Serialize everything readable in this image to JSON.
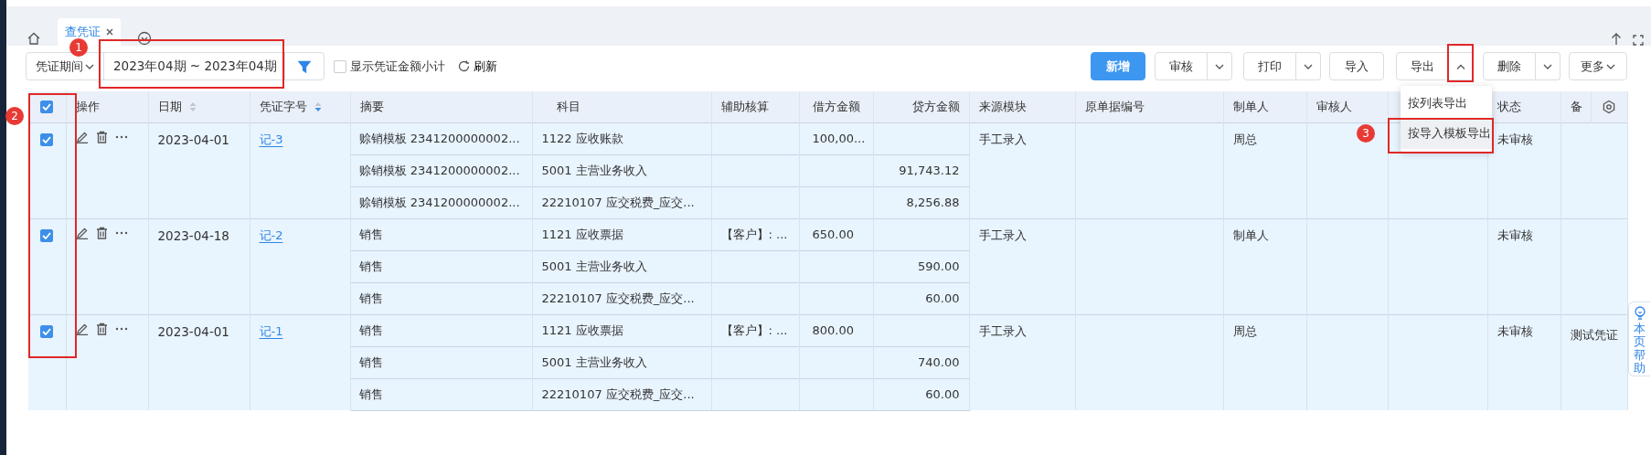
{
  "tabs_bar": {
    "tabs": [
      {
        "label": "查凭证",
        "selected": true
      }
    ]
  },
  "toolbar": {
    "period_select": "凭证期间",
    "date_range": "2023年04期 ~ 2023年04期",
    "subtotal_checkbox": {
      "label": "显示凭证金额小计",
      "checked": false
    },
    "refresh": "刷新",
    "buttons": [
      {
        "label": "新增",
        "kind": "primary"
      },
      {
        "label": "审核",
        "kind": "split",
        "expanded": false
      },
      {
        "label": "打印",
        "kind": "split",
        "expanded": false
      },
      {
        "label": "导入",
        "kind": "plain"
      },
      {
        "label": "导出",
        "kind": "split",
        "expanded": true
      },
      {
        "label": "删除",
        "kind": "split",
        "expanded": false
      },
      {
        "label": "更多",
        "kind": "dropdown"
      }
    ]
  },
  "export_menu": {
    "items": [
      {
        "label": "按列表导出",
        "selected": false
      },
      {
        "label": "按导入模板导出",
        "selected": true
      }
    ]
  },
  "table": {
    "select_all_checked": true,
    "columns": [
      {
        "label": "操作"
      },
      {
        "label": "日期",
        "sortable": true,
        "sorted_desc": false
      },
      {
        "label": "凭证字号",
        "sortable": true,
        "sorted_desc": true
      },
      {
        "label": "摘要"
      },
      {
        "label": "科目"
      },
      {
        "label": "辅助核算"
      },
      {
        "label": "借方金额"
      },
      {
        "label": "贷方金额"
      },
      {
        "label": "来源模块"
      },
      {
        "label": "原单据编号"
      },
      {
        "label": "制单人"
      },
      {
        "label": "审核人"
      },
      {
        "covered": true
      },
      {
        "label": "状态"
      },
      {
        "label": "备"
      }
    ],
    "rows": [
      {
        "checked": true,
        "date": "2023-04-01",
        "voucher_no": "记-3",
        "source": "手工录入",
        "maker": "周总",
        "status": "未审核",
        "entries": [
          {
            "summary": "赊销模板 2341200000002...",
            "account": "1122 应收账款",
            "debit": "100,00..."
          },
          {
            "summary": "赊销模板 2341200000002...",
            "account": "5001 主营业务收入",
            "credit": "91,743.12"
          },
          {
            "summary": "赊销模板 2341200000002...",
            "account": "22210107 应交税费_应交...",
            "credit": "8,256.88"
          }
        ]
      },
      {
        "checked": true,
        "date": "2023-04-18",
        "voucher_no": "记-2",
        "source": "手工录入",
        "maker": "制单人",
        "status": "未审核",
        "entries": [
          {
            "summary": "销售",
            "account": "1121 应收票据",
            "auxiliary": "【客户】: ...",
            "debit": "650.00"
          },
          {
            "summary": "销售",
            "account": "5001 主营业务收入",
            "credit": "590.00"
          },
          {
            "summary": "销售",
            "account": "22210107 应交税费_应交...",
            "credit": "60.00"
          }
        ]
      },
      {
        "checked": true,
        "date": "2023-04-01",
        "voucher_no": "记-1",
        "source": "手工录入",
        "maker": "周总",
        "status": "未审核",
        "remark": "测试凭证",
        "entries": [
          {
            "summary": "销售",
            "account": "1121 应收票据",
            "auxiliary": "【客户】: ...",
            "debit": "800.00"
          },
          {
            "summary": "销售",
            "account": "5001 主营业务收入",
            "credit": "740.00"
          },
          {
            "summary": "销售",
            "account": "22210107 应交税费_应交...",
            "credit": "60.00"
          }
        ]
      }
    ]
  },
  "annotations": [
    {
      "number": "1"
    },
    {
      "number": "2"
    },
    {
      "number": "3"
    }
  ],
  "help_tab": {
    "label": "本页帮助"
  }
}
